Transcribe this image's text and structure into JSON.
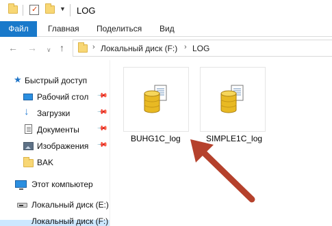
{
  "window": {
    "title": "LOG"
  },
  "ribbon": {
    "tabs": [
      {
        "label": "Файл",
        "active": true
      },
      {
        "label": "Главная"
      },
      {
        "label": "Поделиться"
      },
      {
        "label": "Вид"
      }
    ]
  },
  "address": {
    "breadcrumbs": [
      "Локальный диск (F:)",
      "LOG"
    ],
    "separator": "›"
  },
  "navpane": {
    "quick_access": "Быстрый доступ",
    "items": [
      {
        "label": "Рабочий стол",
        "icon": "desktop-icon",
        "pinned": true
      },
      {
        "label": "Загрузки",
        "icon": "download-icon",
        "pinned": true
      },
      {
        "label": "Документы",
        "icon": "documents-icon",
        "pinned": true
      },
      {
        "label": "Изображения",
        "icon": "pictures-icon",
        "pinned": true
      },
      {
        "label": "BAK",
        "icon": "folder-icon",
        "pinned": false
      }
    ],
    "this_pc": "Этот компьютер",
    "drives": [
      {
        "label": "Локальный диск (E:)",
        "icon": "drive-icon"
      },
      {
        "label": "Локальный диск (F:)",
        "icon": "drive-icon",
        "selected": true
      }
    ]
  },
  "files": [
    {
      "name": "BUHG1C_log",
      "icon": "database-icon"
    },
    {
      "name": "SIMPLE1C_log",
      "icon": "database-icon"
    }
  ],
  "colors": {
    "file_tab": "#1979ca",
    "arrow": "#b5412c",
    "selection": "#cce8ff"
  }
}
